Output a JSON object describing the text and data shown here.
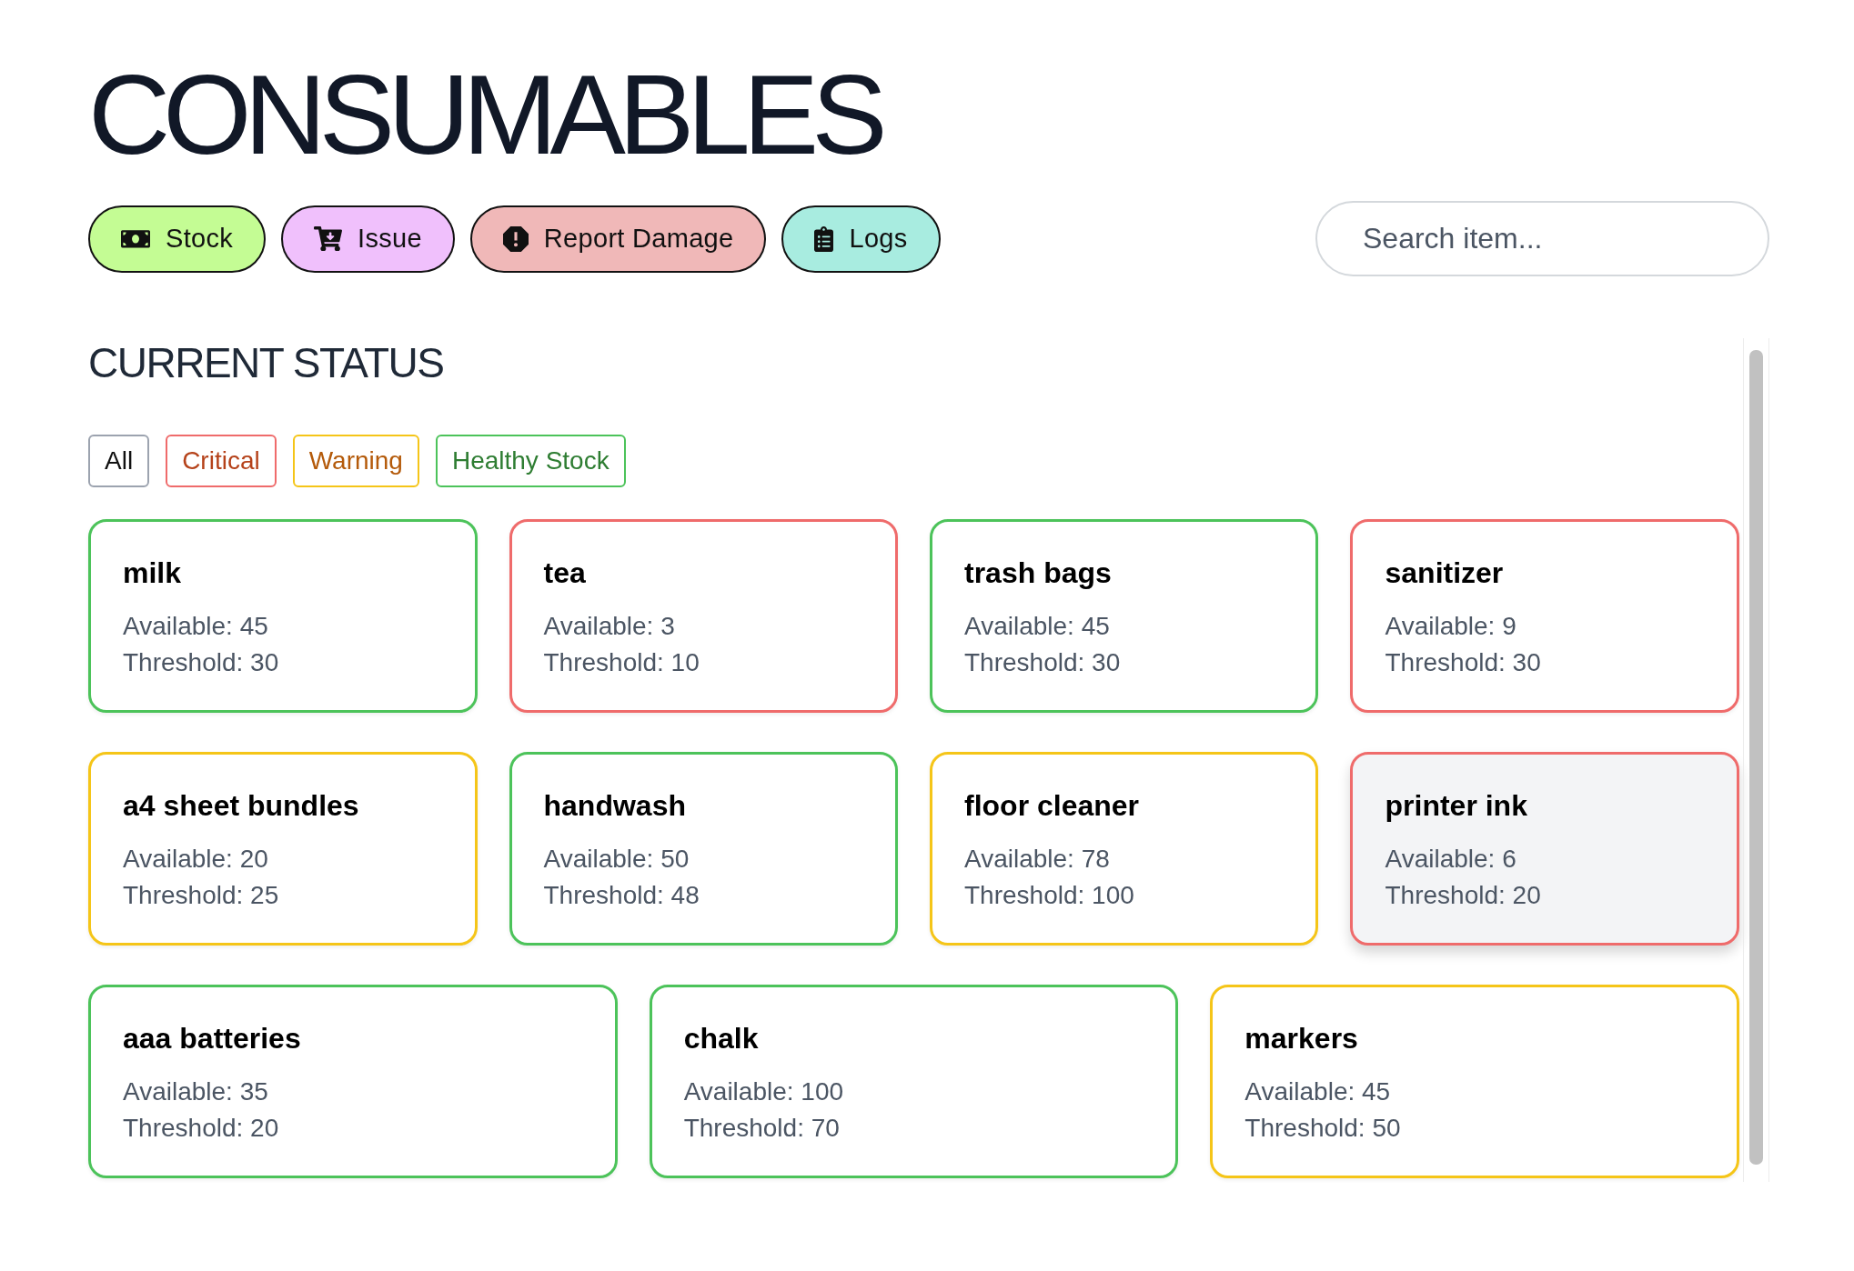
{
  "page": {
    "title": "CONSUMABLES"
  },
  "actions": [
    {
      "kind": "stock",
      "label": "Stock",
      "color": "#c4fc94"
    },
    {
      "kind": "issue",
      "label": "Issue",
      "color": "#f0c0fc"
    },
    {
      "kind": "damage",
      "label": "Report Damage",
      "color": "#f0b8b8"
    },
    {
      "kind": "logs",
      "label": "Logs",
      "color": "#a8ece0"
    }
  ],
  "search": {
    "placeholder": "Search item..."
  },
  "status_section": {
    "heading": "CURRENT STATUS",
    "filters": [
      {
        "kind": "all",
        "label": "All"
      },
      {
        "kind": "critical",
        "label": "Critical"
      },
      {
        "kind": "warning",
        "label": "Warning"
      },
      {
        "kind": "healthy",
        "label": "Healthy Stock"
      }
    ],
    "cards": [
      {
        "name": "milk",
        "available": "Available: 45",
        "threshold": "Threshold: 30",
        "color": "#4cc35a",
        "hovered": false
      },
      {
        "name": "tea",
        "available": "Available: 3",
        "threshold": "Threshold: 10",
        "color": "#ef6b6b",
        "hovered": false
      },
      {
        "name": "trash bags",
        "available": "Available: 45",
        "threshold": "Threshold: 30",
        "color": "#4cc35a",
        "hovered": false
      },
      {
        "name": "sanitizer",
        "available": "Available: 9",
        "threshold": "Threshold: 30",
        "color": "#ef6b6b",
        "hovered": false
      },
      {
        "name": "a4 sheet bundles",
        "available": "Available: 20",
        "threshold": "Threshold: 25",
        "color": "#f5c518",
        "hovered": false
      },
      {
        "name": "handwash",
        "available": "Available: 50",
        "threshold": "Threshold: 48",
        "color": "#4cc35a",
        "hovered": false
      },
      {
        "name": "floor cleaner",
        "available": "Available: 78",
        "threshold": "Threshold: 100",
        "color": "#f5c518",
        "hovered": false
      },
      {
        "name": "printer ink",
        "available": "Available: 6",
        "threshold": "Threshold: 20",
        "color": "#ef6b6b",
        "hovered": true
      },
      {
        "name": "aaa batteries",
        "available": "Available: 35",
        "threshold": "Threshold: 20",
        "color": "#4cc35a",
        "hovered": false
      },
      {
        "name": "chalk",
        "available": "Available: 100",
        "threshold": "Threshold: 70",
        "color": "#4cc35a",
        "hovered": false
      },
      {
        "name": "markers",
        "available": "Available: 45",
        "threshold": "Threshold: 50",
        "color": "#f5c518",
        "hovered": false
      }
    ]
  }
}
